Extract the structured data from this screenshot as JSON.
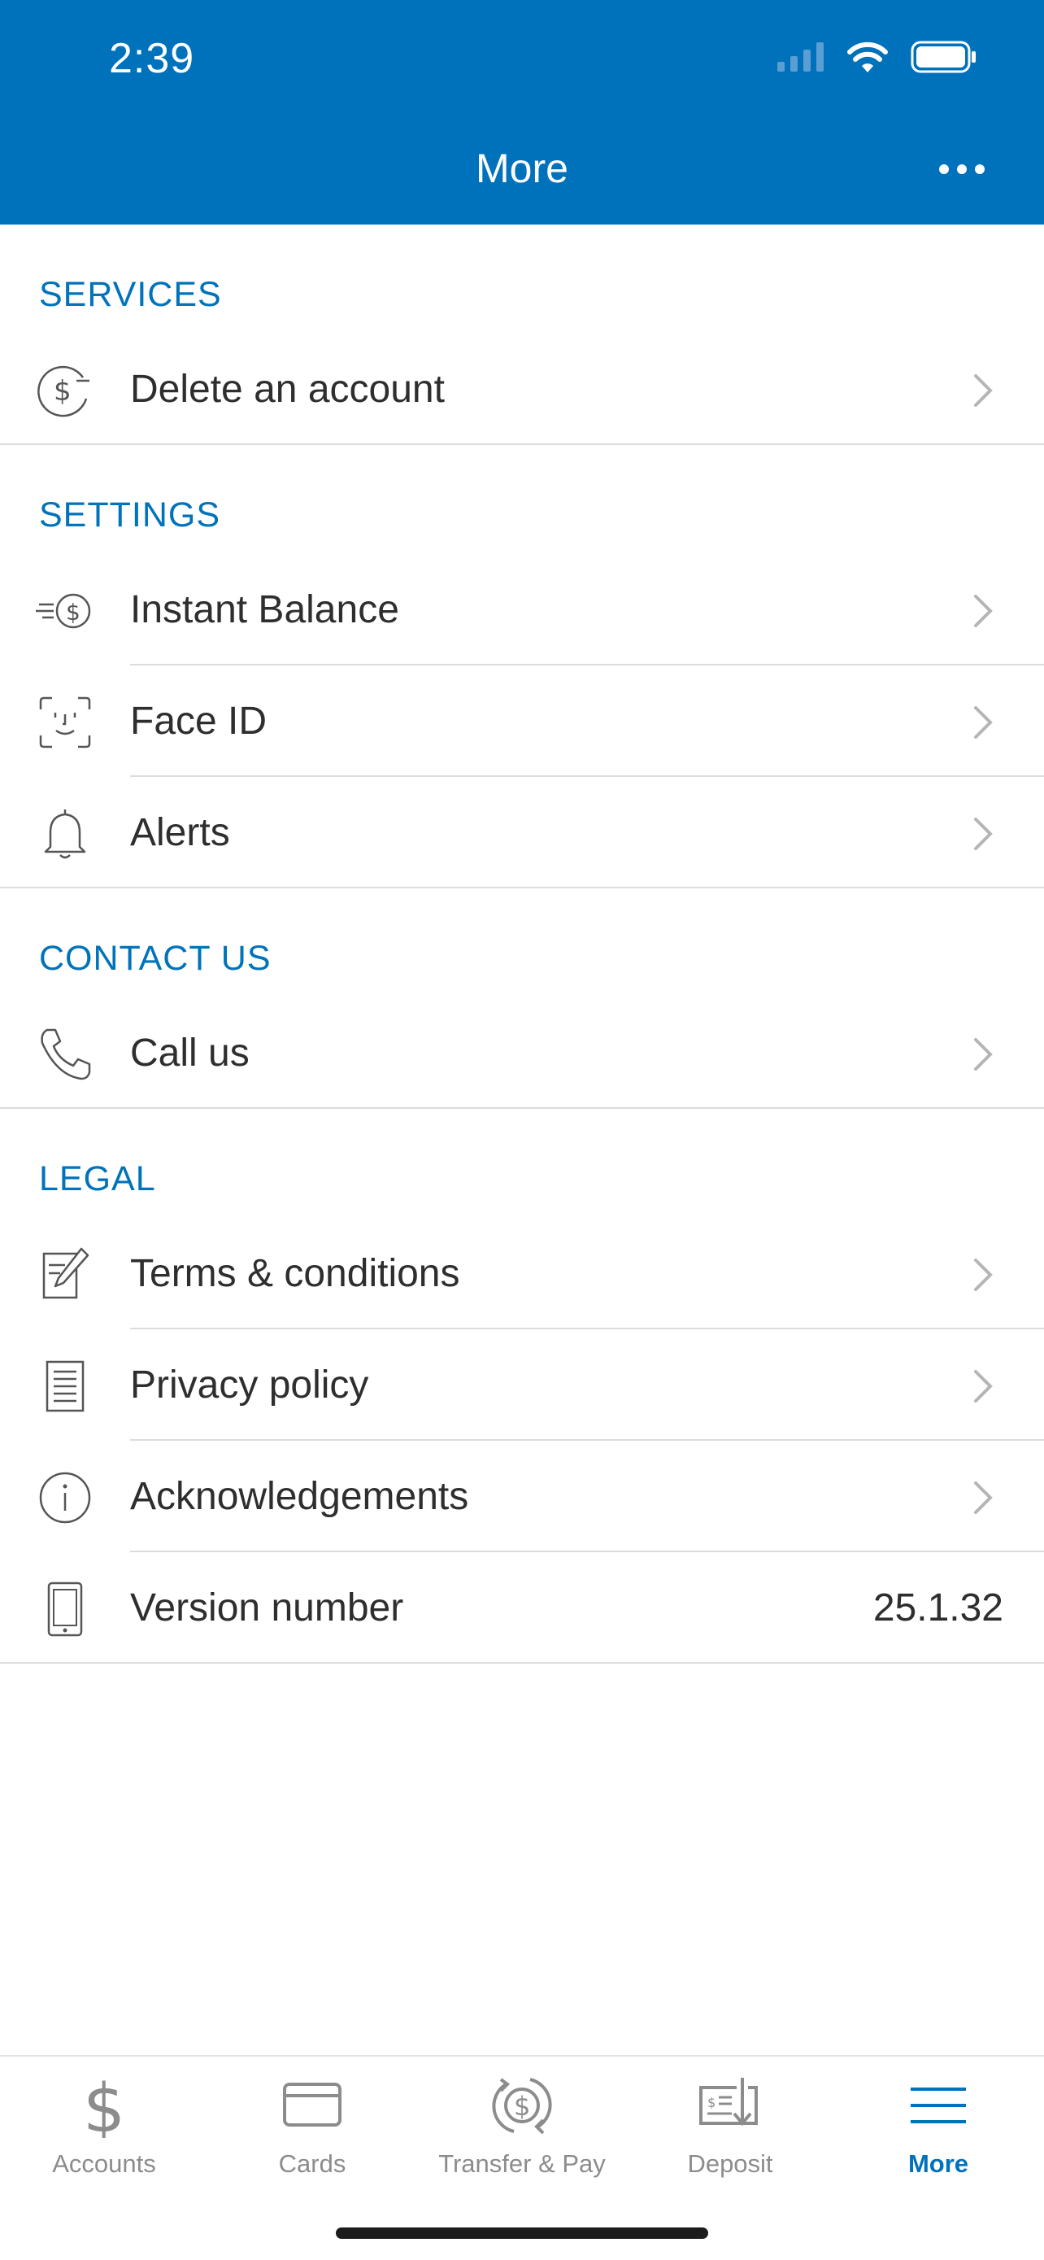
{
  "status_bar": {
    "time": "2:39"
  },
  "header": {
    "title": "More"
  },
  "sections": {
    "services": {
      "title": "SERVICES",
      "items": [
        {
          "label": "Delete an account",
          "icon": "dollar-minus-icon"
        }
      ]
    },
    "settings": {
      "title": "SETTINGS",
      "items": [
        {
          "label": "Instant Balance",
          "icon": "instant-balance-icon"
        },
        {
          "label": "Face ID",
          "icon": "face-id-icon"
        },
        {
          "label": "Alerts",
          "icon": "bell-icon"
        }
      ]
    },
    "contact": {
      "title": "CONTACT US",
      "items": [
        {
          "label": "Call us",
          "icon": "phone-icon"
        }
      ]
    },
    "legal": {
      "title": "LEGAL",
      "items": [
        {
          "label": "Terms & conditions",
          "icon": "document-pencil-icon"
        },
        {
          "label": "Privacy policy",
          "icon": "document-lines-icon"
        },
        {
          "label": "Acknowledgements",
          "icon": "info-icon"
        },
        {
          "label": "Version number",
          "value": "25.1.32",
          "icon": "phone-device-icon"
        }
      ]
    }
  },
  "tabbar": {
    "tabs": [
      {
        "label": "Accounts",
        "icon": "dollar-icon"
      },
      {
        "label": "Cards",
        "icon": "card-icon"
      },
      {
        "label": "Transfer & Pay",
        "icon": "transfer-icon"
      },
      {
        "label": "Deposit",
        "icon": "check-deposit-icon"
      },
      {
        "label": "More",
        "icon": "hamburger-icon",
        "active": true
      }
    ]
  },
  "colors": {
    "brand": "#0072bc",
    "section_title": "#0073bb",
    "tab_inactive": "#8c8c8c"
  }
}
